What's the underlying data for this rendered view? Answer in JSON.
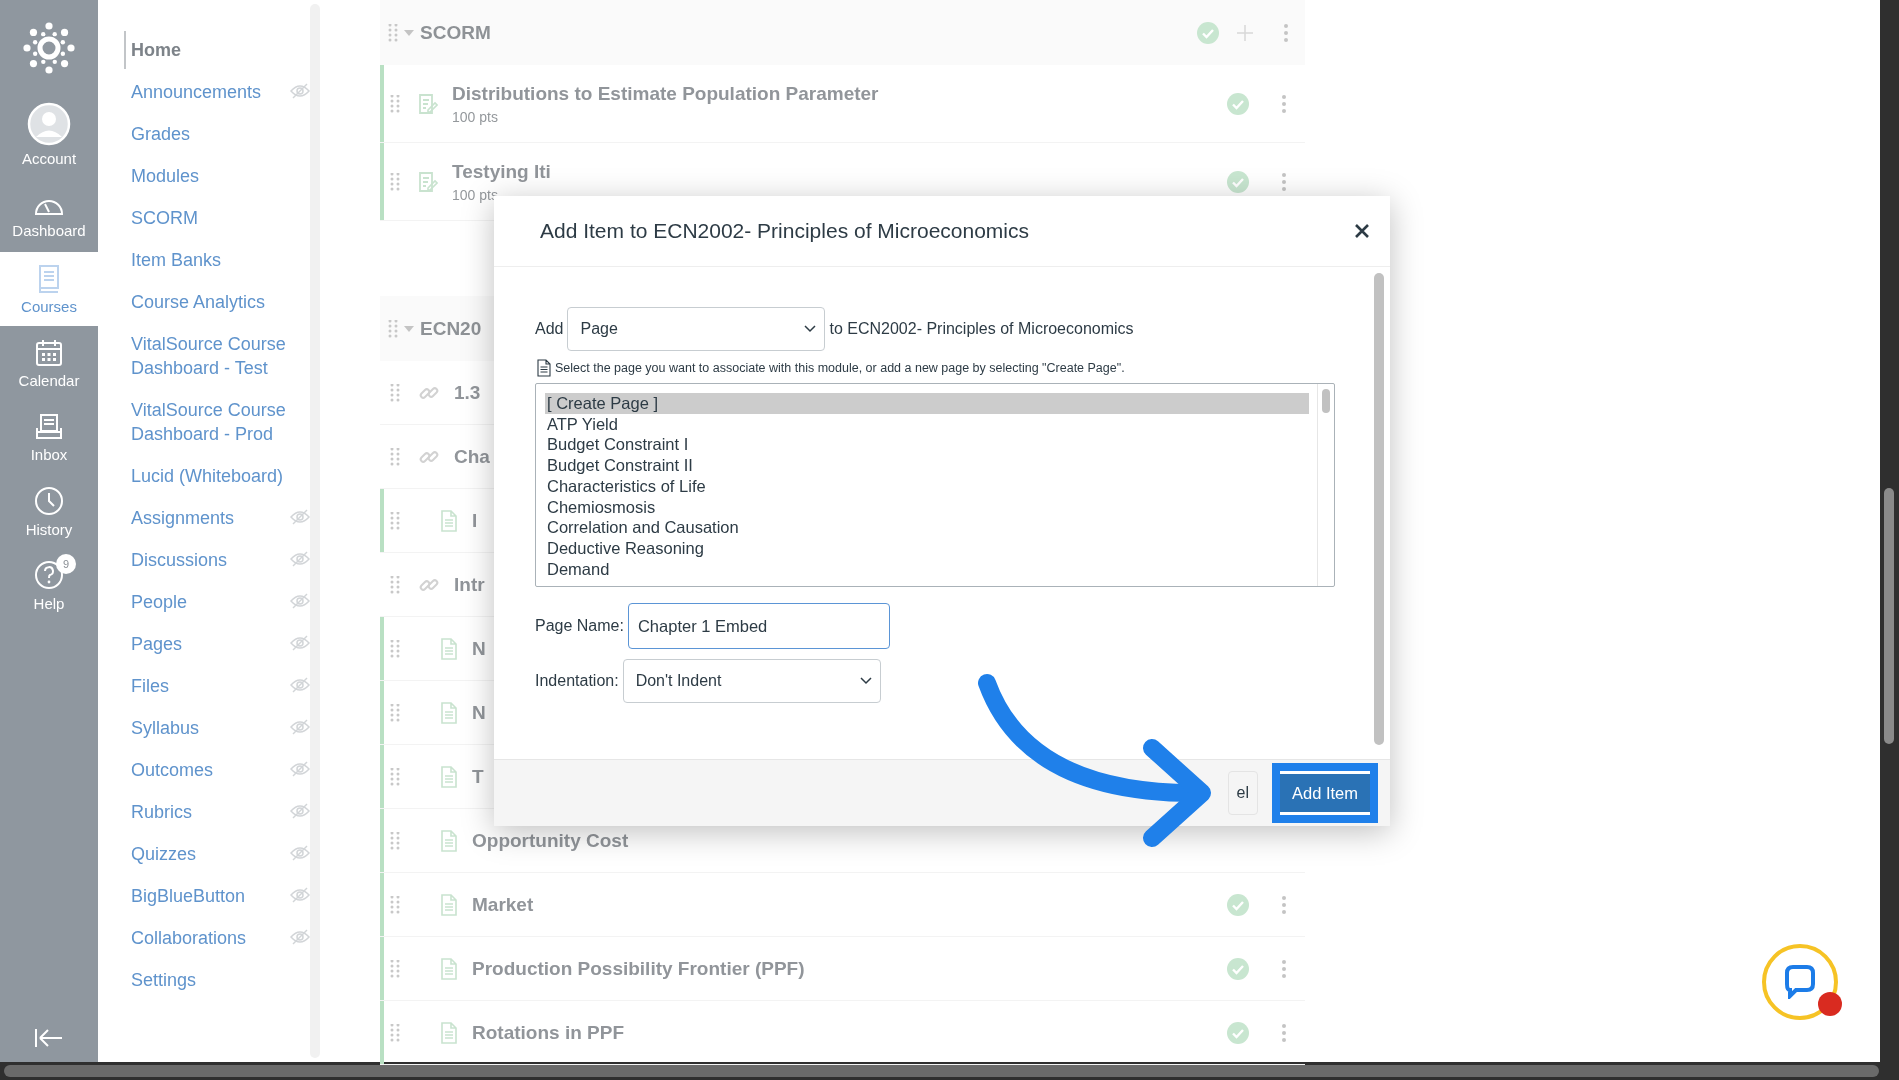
{
  "global_nav": {
    "items": [
      {
        "kind": "account",
        "label": "Account",
        "selected": false
      },
      {
        "kind": "dashboard",
        "label": "Dashboard",
        "selected": false
      },
      {
        "kind": "courses",
        "label": "Courses",
        "selected": true
      },
      {
        "kind": "calendar",
        "label": "Calendar",
        "selected": false
      },
      {
        "kind": "inbox",
        "label": "Inbox",
        "selected": false
      },
      {
        "kind": "history",
        "label": "History",
        "selected": false
      },
      {
        "kind": "help",
        "label": "Help",
        "selected": false,
        "badge": "9"
      }
    ]
  },
  "course_nav": {
    "items": [
      {
        "label": "Home",
        "selected": true,
        "hidden": false
      },
      {
        "label": "Announcements",
        "selected": false,
        "hidden": true
      },
      {
        "label": "Grades",
        "selected": false,
        "hidden": false
      },
      {
        "label": "Modules",
        "selected": false,
        "hidden": false
      },
      {
        "label": "SCORM",
        "selected": false,
        "hidden": false
      },
      {
        "label": "Item Banks",
        "selected": false,
        "hidden": false
      },
      {
        "label": "Course Analytics",
        "selected": false,
        "hidden": false
      },
      {
        "label": "VitalSource Course Dashboard - Test",
        "selected": false,
        "hidden": false
      },
      {
        "label": "VitalSource Course Dashboard - Prod",
        "selected": false,
        "hidden": false
      },
      {
        "label": "Lucid (Whiteboard)",
        "selected": false,
        "hidden": false
      },
      {
        "label": "Assignments",
        "selected": false,
        "hidden": true
      },
      {
        "label": "Discussions",
        "selected": false,
        "hidden": true
      },
      {
        "label": "People",
        "selected": false,
        "hidden": true
      },
      {
        "label": "Pages",
        "selected": false,
        "hidden": true
      },
      {
        "label": "Files",
        "selected": false,
        "hidden": true
      },
      {
        "label": "Syllabus",
        "selected": false,
        "hidden": true
      },
      {
        "label": "Outcomes",
        "selected": false,
        "hidden": true
      },
      {
        "label": "Rubrics",
        "selected": false,
        "hidden": true
      },
      {
        "label": "Quizzes",
        "selected": false,
        "hidden": true
      },
      {
        "label": "BigBlueButton",
        "selected": false,
        "hidden": true
      },
      {
        "label": "Collaborations",
        "selected": false,
        "hidden": true
      },
      {
        "label": "Settings",
        "selected": false,
        "hidden": false
      }
    ]
  },
  "modules": [
    {
      "title": "SCORM",
      "expanded": true,
      "published": true,
      "items": [
        {
          "kind": "quiz",
          "title": "Distributions to Estimate Population Parameter",
          "subtitle": "100 pts",
          "highlighted": true,
          "published": true
        },
        {
          "kind": "quiz",
          "title": "Testying Iti",
          "subtitle": "100 pts",
          "highlighted": true,
          "published": true
        }
      ]
    },
    {
      "title": "ECN20",
      "expanded": true,
      "items": [
        {
          "kind": "link",
          "title": "1.3",
          "highlighted": false
        },
        {
          "kind": "link",
          "title": "Cha",
          "highlighted": false
        },
        {
          "kind": "page",
          "title": "I",
          "highlighted": true
        },
        {
          "kind": "link",
          "title": "Intr",
          "highlighted": false
        },
        {
          "kind": "page",
          "title": "N",
          "highlighted": true
        },
        {
          "kind": "page",
          "title": "N",
          "highlighted": true
        },
        {
          "kind": "page",
          "title": "T",
          "highlighted": true
        },
        {
          "kind": "page",
          "title": "Opportunity Cost",
          "highlighted": true
        },
        {
          "kind": "page",
          "title": "Market",
          "highlighted": true,
          "published": true
        },
        {
          "kind": "page",
          "title": "Production Possibility Frontier (PPF)",
          "highlighted": true,
          "published": true
        },
        {
          "kind": "page",
          "title": "Rotations in PPF",
          "highlighted": true,
          "published": true
        }
      ]
    }
  ],
  "dialog": {
    "title": "Add Item to ECN2002- Principles of Microeconomics",
    "add_label": "Add",
    "type_select": "Page",
    "target_text": "to ECN2002- Principles of Microeconomics",
    "hint": "Select the page you want to associate with this module, or add a new page by selecting \"Create Page\".",
    "options": [
      {
        "label": "[ Create Page ]",
        "selected": true
      },
      {
        "label": "ATP Yield",
        "selected": false
      },
      {
        "label": "Budget Constraint I",
        "selected": false
      },
      {
        "label": "Budget Constraint II",
        "selected": false
      },
      {
        "label": "Characteristics of Life",
        "selected": false
      },
      {
        "label": "Chemiosmosis",
        "selected": false
      },
      {
        "label": "Correlation and Causation",
        "selected": false
      },
      {
        "label": "Deductive Reasoning",
        "selected": false
      },
      {
        "label": "Demand",
        "selected": false
      }
    ],
    "page_name": {
      "label": "Page Name:",
      "value": "Chapter 1 Embed"
    },
    "indentation": {
      "label": "Indentation:",
      "value": "Don't Indent"
    },
    "cancel_button": "el",
    "submit_button": {
      "label": "Add Item",
      "highlighted": true
    }
  },
  "chat_widget": {
    "notification": true
  }
}
